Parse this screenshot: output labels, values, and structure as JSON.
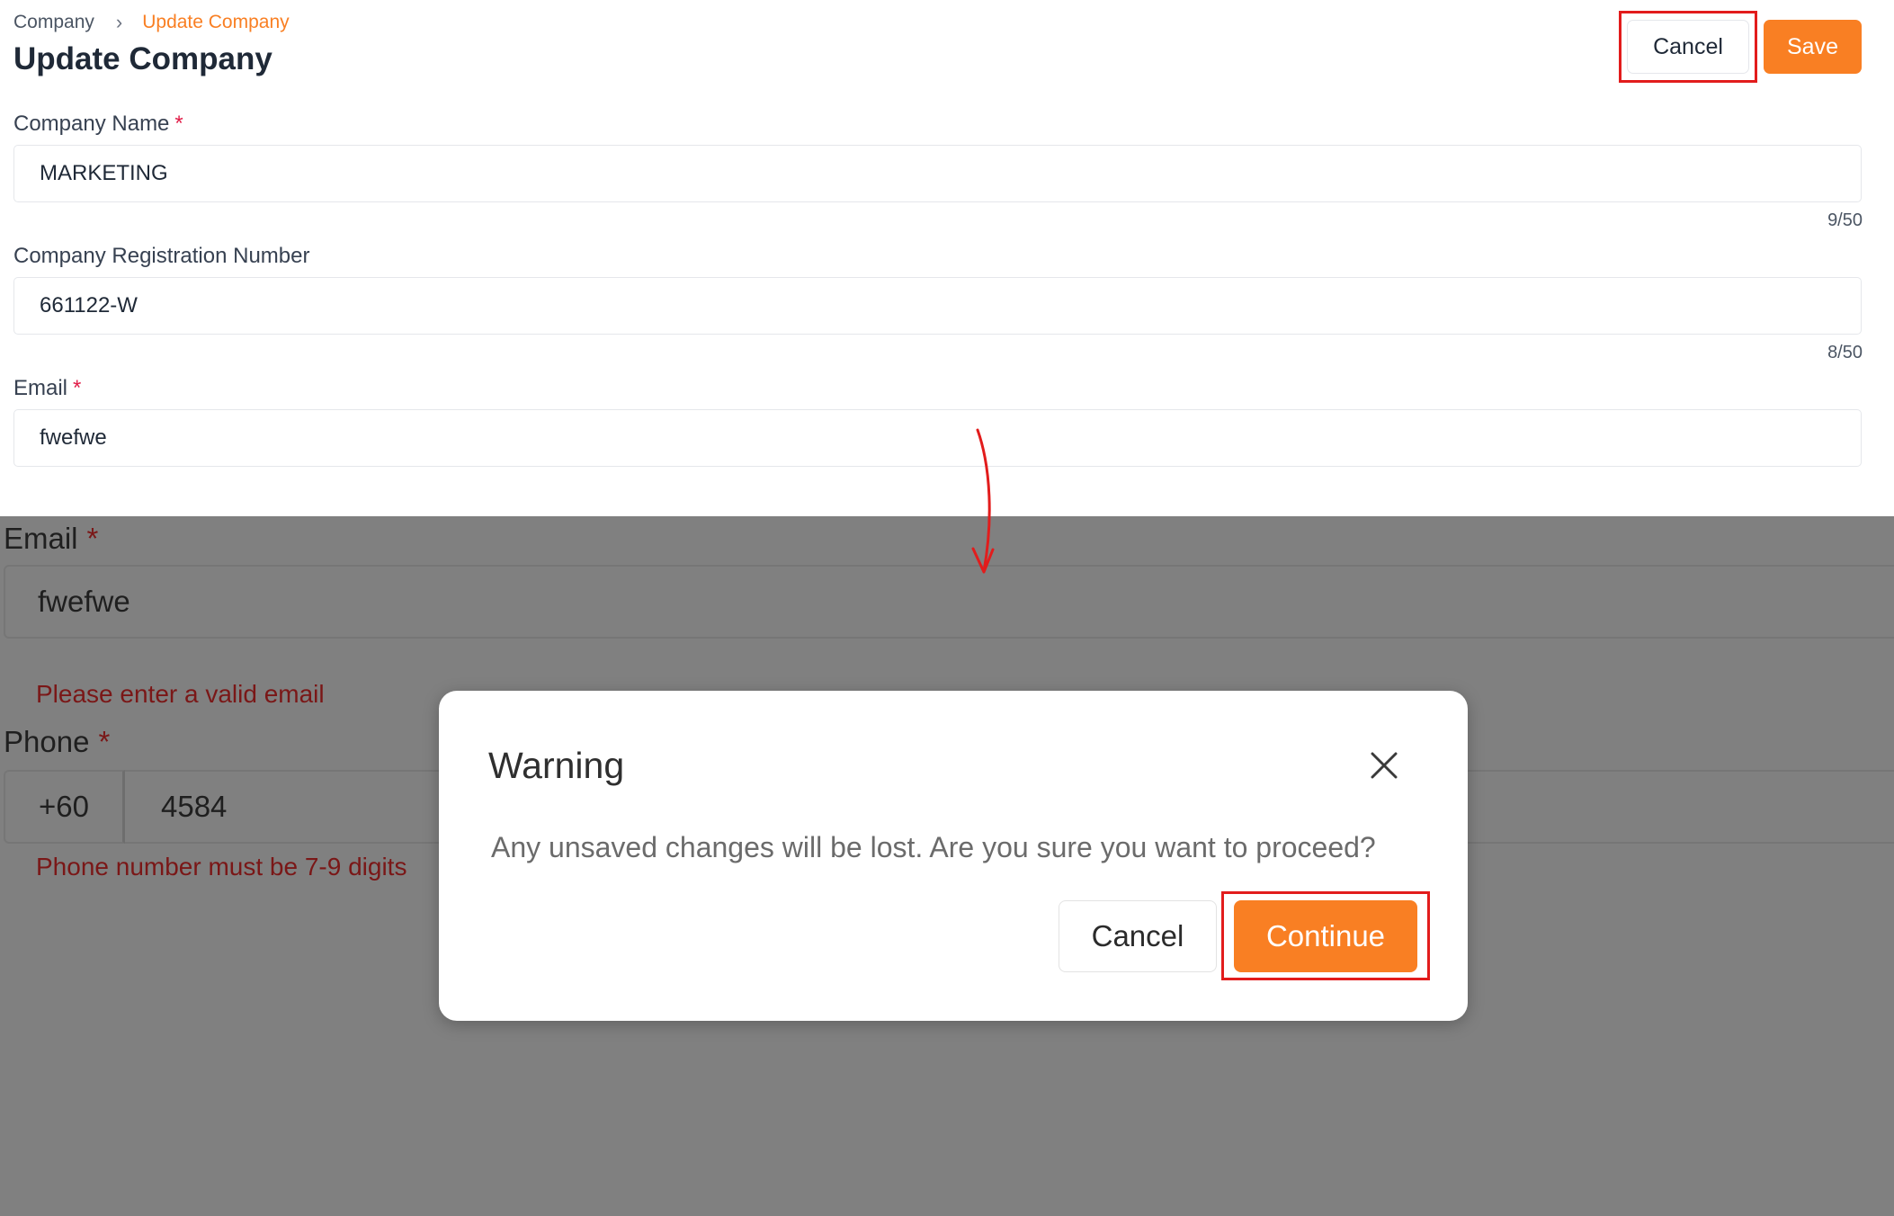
{
  "breadcrumb": {
    "parent": "Company",
    "separator": "›",
    "current": "Update Company"
  },
  "page": {
    "title": "Update Company"
  },
  "header_actions": {
    "cancel_label": "Cancel",
    "save_label": "Save"
  },
  "form": {
    "company_name": {
      "label": "Company Name",
      "required_mark": "*",
      "value": "MARKETING",
      "counter": "9/50"
    },
    "registration_number": {
      "label": "Company Registration Number",
      "value": "661122-W",
      "counter": "8/50"
    },
    "email": {
      "label": "Email",
      "required_mark": "*",
      "value": "fwefwe"
    }
  },
  "zoomed_form": {
    "email": {
      "label": "Email",
      "required_mark": "*",
      "value": "fwefwe",
      "error": "Please enter a valid email"
    },
    "phone": {
      "label": "Phone",
      "required_mark": "*",
      "country_code": "+60",
      "value": "4584",
      "error": "Phone number must be 7-9 digits"
    }
  },
  "modal": {
    "title": "Warning",
    "message": "Any unsaved changes will be lost. Are you sure you want to proceed?",
    "cancel_label": "Cancel",
    "continue_label": "Continue",
    "close_icon": "close-icon"
  },
  "colors": {
    "accent": "#f97f23",
    "highlight": "#e21c1c",
    "error": "#7a1717",
    "overlay": "#808080"
  }
}
